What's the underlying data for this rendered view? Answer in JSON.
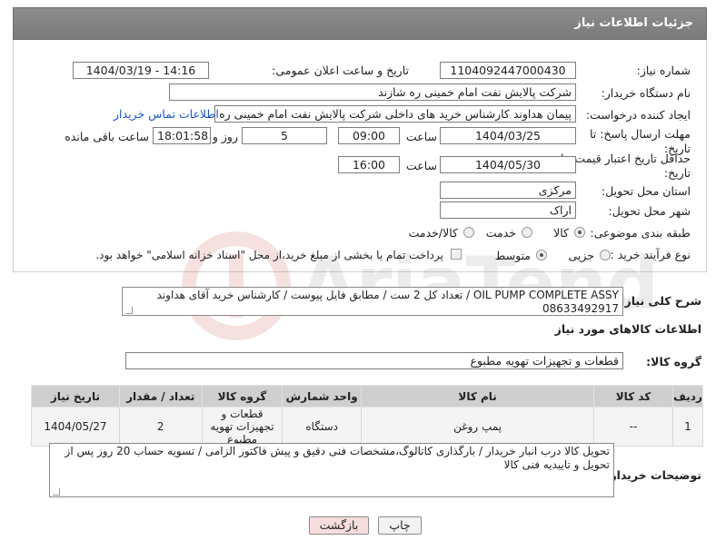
{
  "header": {
    "title": "جزئیات اطلاعات نیاز"
  },
  "form": {
    "need_number_label": "شماره نیاز:",
    "need_number": "1104092447000430",
    "announce_label": "تاریخ و ساعت اعلان عمومی:",
    "announce_value": "1404/03/19 - 14:16",
    "buyer_org_label": "نام دستگاه خریدار:",
    "buyer_org": "شرکت پالایش نفت امام خمینی  ره  شازند",
    "requester_label": "ایجاد کننده درخواست:",
    "requester": "پیمان هداوند کارشناس خرید های داخلی  شرکت پالایش نفت امام خمینی  ره",
    "contact_link": "اطلاعات تماس خریدار",
    "deadline_label": "مهلت ارسال پاسخ: تا تاریخ:",
    "deadline_date": "1404/03/25",
    "time_label": "ساعت",
    "deadline_time": "09:00",
    "days": "5",
    "days_label": "روز و",
    "remaining_time": "18:01:58",
    "remaining_label": "ساعت باقی مانده",
    "validity_label": "حداقل تاریخ اعتبار قیمت: تا تاریخ:",
    "validity_date": "1404/05/30",
    "validity_time": "16:00",
    "province_label": "استان محل تحویل:",
    "province": "مرکزی",
    "city_label": "شهر محل تحویل:",
    "city": "اراک",
    "category_label": "طبقه بندی موضوعی:",
    "category_options": [
      "کالا",
      "خدمت",
      "کالا/خدمت"
    ],
    "process_label": "نوع فرآیند خرید :",
    "process_options": [
      "جزیی",
      "متوسط"
    ],
    "payment_note": "پرداخت تمام یا بخشی از مبلغ خرید،از محل \"اسناد خزانه اسلامی\" خواهد بود."
  },
  "summary": {
    "label": "شرح کلی نیاز:",
    "text": "OIL PUMP COMPLETE ASSY  / تعداد کل 2 ست / مطابق فایل پیوست / کارشناس خرید آقای هداوند 08633492917"
  },
  "goods_info": {
    "title": "اطلاعات کالاهای مورد نیاز"
  },
  "goods_group": {
    "label": "گروه کالا:",
    "value": "قطعات و تجهیزات تهویه مطبوع"
  },
  "table": {
    "headers": [
      "ردیف",
      "کد کالا",
      "نام کالا",
      "واحد شمارش",
      "گروه کالا",
      "تعداد / مقدار",
      "تاریخ نیاز"
    ],
    "rows": [
      [
        "1",
        "--",
        "پمپ روغن",
        "دستگاه",
        "قطعات و تجهیزات تهویه مطبوع",
        "2",
        "1404/05/27"
      ]
    ]
  },
  "buyer_notes": {
    "label": "توضیحات خریدار:",
    "text": "تحویل کالا درب انبار خریدار / بارگذاری کاتالوگ،مشخصات فنی دقیق و پیش فاکتور الزامی / تسویه حساب 20 روز پس از تحویل و تاییدیه فنی کالا"
  },
  "buttons": {
    "print": "چاپ",
    "back": "بازگشت"
  },
  "colors": {
    "header_bg": "#808080",
    "link": "#1a55c7",
    "back_button_bg": "#f7dede"
  }
}
